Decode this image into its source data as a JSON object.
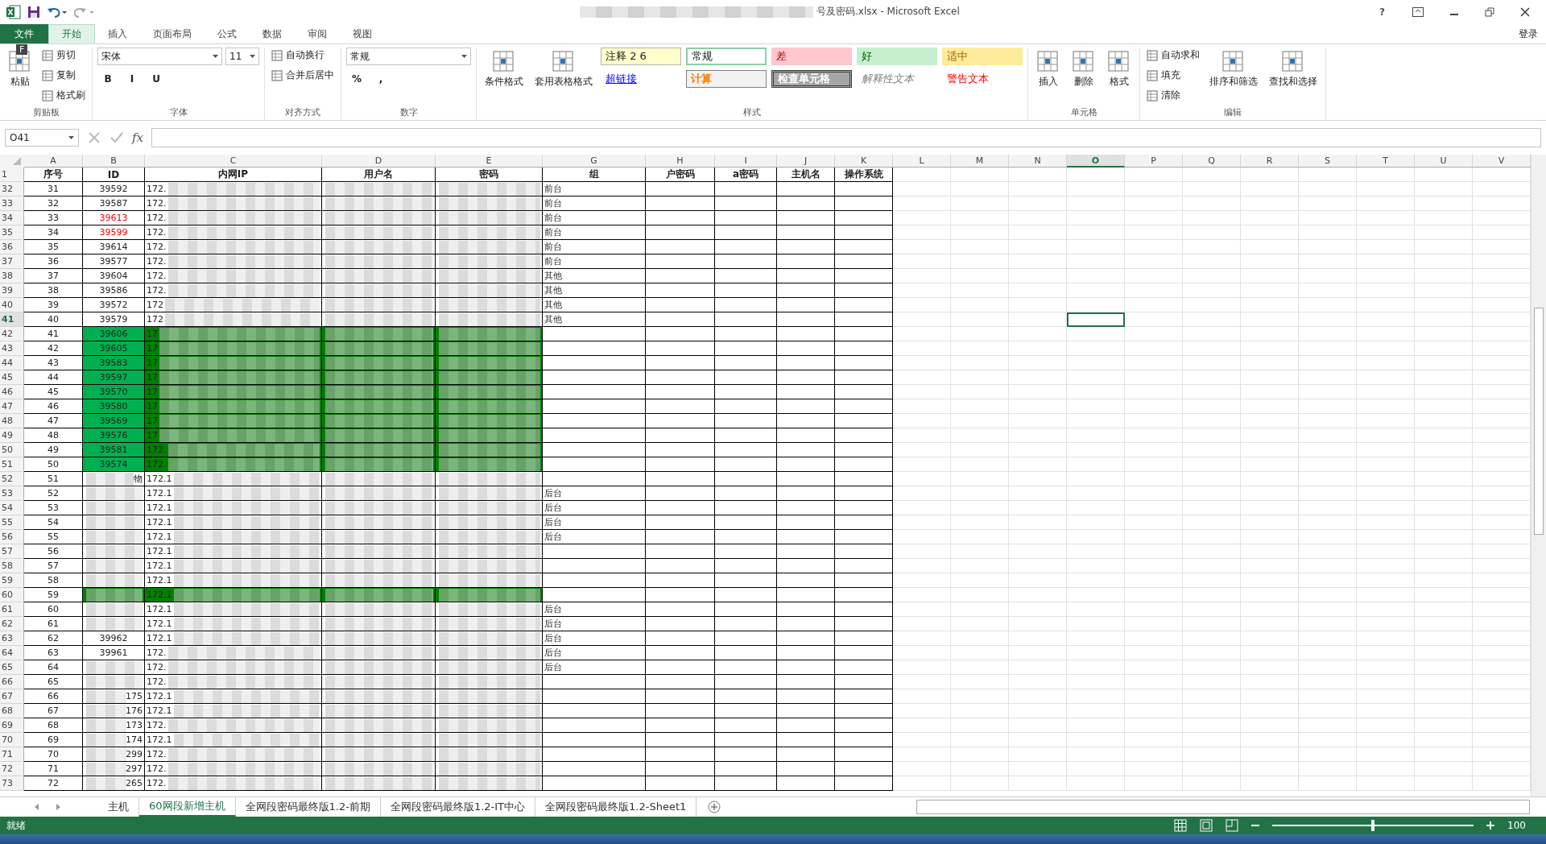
{
  "window": {
    "title": "号及密码.xlsx - Microsoft Excel",
    "help": "?",
    "sign_in": "登录"
  },
  "tabs": [
    {
      "label": "文件",
      "kind": "file",
      "selected": false
    },
    {
      "label": "开始",
      "kind": "tab",
      "selected": true
    },
    {
      "label": "插入",
      "kind": "tab",
      "selected": false
    },
    {
      "label": "页面布局",
      "kind": "tab",
      "selected": false
    },
    {
      "label": "公式",
      "kind": "tab",
      "selected": false
    },
    {
      "label": "数据",
      "kind": "tab",
      "selected": false
    },
    {
      "label": "审阅",
      "kind": "tab",
      "selected": false
    },
    {
      "label": "视图",
      "kind": "tab",
      "selected": false
    }
  ],
  "key_tip": "F",
  "ribbon": [
    {
      "label": "剪贴板",
      "columns": [
        {
          "items": [
            {
              "kind": "large",
              "label": "粘贴"
            }
          ]
        },
        {
          "items": [
            {
              "kind": "small",
              "label": "剪切"
            },
            {
              "kind": "small",
              "label": "复制"
            },
            {
              "kind": "small",
              "label": "格式刷"
            }
          ]
        }
      ]
    },
    {
      "label": "字体",
      "columns": [
        {
          "items": [
            {
              "kind": "fields",
              "labels": [
                "宋体",
                "11"
              ]
            },
            {
              "kind": "glyphs",
              "labels": [
                "B",
                "I",
                "U"
              ]
            }
          ]
        }
      ]
    },
    {
      "label": "对齐方式",
      "columns": [
        {
          "items": [
            {
              "kind": "small",
              "label": "自动换行"
            },
            {
              "kind": "small",
              "label": "合并后居中"
            }
          ]
        }
      ]
    },
    {
      "label": "数字",
      "columns": [
        {
          "items": [
            {
              "kind": "fields",
              "labels": [
                "常规"
              ]
            },
            {
              "kind": "glyphs",
              "labels": [
                "%",
                ","
              ]
            }
          ]
        }
      ]
    },
    {
      "label": "样式",
      "columns": [
        {
          "items": [
            {
              "kind": "large",
              "label": "条件格式"
            }
          ]
        },
        {
          "items": [
            {
              "kind": "large",
              "label": "套用表格格式"
            }
          ]
        },
        {
          "items": [
            {
              "kind": "style",
              "label": "注释 2 6"
            },
            {
              "kind": "style",
              "label": "超链接"
            }
          ]
        },
        {
          "items": [
            {
              "kind": "style",
              "label": "常规"
            },
            {
              "kind": "style",
              "label": "计算"
            }
          ]
        },
        {
          "items": [
            {
              "kind": "style",
              "label": "差"
            },
            {
              "kind": "style",
              "label": "检查单元格"
            }
          ]
        },
        {
          "items": [
            {
              "kind": "style",
              "label": "好"
            },
            {
              "kind": "style",
              "label": "解释性文本"
            }
          ]
        },
        {
          "items": [
            {
              "kind": "style",
              "label": "适中"
            },
            {
              "kind": "style",
              "label": "警告文本"
            }
          ]
        }
      ]
    },
    {
      "label": "单元格",
      "columns": [
        {
          "items": [
            {
              "kind": "large",
              "label": "插入"
            }
          ]
        },
        {
          "items": [
            {
              "kind": "large",
              "label": "删除"
            }
          ]
        },
        {
          "items": [
            {
              "kind": "large",
              "label": "格式"
            }
          ]
        }
      ]
    },
    {
      "label": "编辑",
      "columns": [
        {
          "items": [
            {
              "kind": "small",
              "label": "自动求和"
            },
            {
              "kind": "small",
              "label": "填充"
            },
            {
              "kind": "small",
              "label": "清除"
            }
          ]
        },
        {
          "items": [
            {
              "kind": "large",
              "label": "排序和筛选"
            }
          ]
        },
        {
          "items": [
            {
              "kind": "large",
              "label": "查找和选择"
            }
          ]
        }
      ]
    }
  ],
  "formula_bar": {
    "name_box": "O41",
    "fx": "fx"
  },
  "header_row": "1",
  "columns": [
    {
      "letter": "A",
      "heading": "序号",
      "redacted": false,
      "active": false
    },
    {
      "letter": "B",
      "heading": "ID",
      "redacted": false,
      "active": false
    },
    {
      "letter": "C",
      "heading": "内网IP",
      "redacted": true,
      "active": false
    },
    {
      "letter": "D",
      "heading": "用户名",
      "redacted": true,
      "active": false
    },
    {
      "letter": "E",
      "heading": "密码",
      "redacted": true,
      "active": false
    },
    {
      "letter": "G",
      "heading": "组",
      "redacted": false,
      "active": false
    },
    {
      "letter": "H",
      "heading": "户密码",
      "redacted": false,
      "active": false
    },
    {
      "letter": "I",
      "heading": "a密码",
      "redacted": false,
      "active": false
    },
    {
      "letter": "J",
      "heading": "主机名",
      "redacted": false,
      "active": false
    },
    {
      "letter": "K",
      "heading": "操作系统",
      "redacted": false,
      "active": false
    },
    {
      "letter": "L",
      "active": false
    },
    {
      "letter": "M",
      "active": false
    },
    {
      "letter": "N",
      "active": false
    },
    {
      "letter": "O",
      "active": true
    },
    {
      "letter": "P",
      "active": false
    },
    {
      "letter": "Q",
      "active": false
    },
    {
      "letter": "R",
      "active": false
    },
    {
      "letter": "S",
      "active": false
    },
    {
      "letter": "T",
      "active": false
    },
    {
      "letter": "U",
      "active": false
    },
    {
      "letter": "V",
      "active": false
    }
  ],
  "rows": [
    {
      "number": "32",
      "seq": "31",
      "id": "39592",
      "id_red": false,
      "id_redacted": false,
      "ip": "172.",
      "group": "前台",
      "highlighted": false,
      "active": false
    },
    {
      "number": "33",
      "seq": "32",
      "id": "39587",
      "id_red": false,
      "id_redacted": false,
      "ip": "172.",
      "group": "前台",
      "highlighted": false,
      "active": false
    },
    {
      "number": "34",
      "seq": "33",
      "id": "39613",
      "id_red": true,
      "id_redacted": false,
      "ip": "172.",
      "group": "前台",
      "highlighted": false,
      "active": false
    },
    {
      "number": "35",
      "seq": "34",
      "id": "39599",
      "id_red": true,
      "id_redacted": false,
      "ip": "172.",
      "group": "前台",
      "highlighted": false,
      "active": false
    },
    {
      "number": "36",
      "seq": "35",
      "id": "39614",
      "id_red": false,
      "id_redacted": false,
      "ip": "172.",
      "group": "前台",
      "highlighted": false,
      "active": false
    },
    {
      "number": "37",
      "seq": "36",
      "id": "39577",
      "id_red": false,
      "id_redacted": false,
      "ip": "172.",
      "group": "前台",
      "highlighted": false,
      "active": false
    },
    {
      "number": "38",
      "seq": "37",
      "id": "39604",
      "id_red": false,
      "id_redacted": false,
      "ip": "172.",
      "group": "其他",
      "highlighted": false,
      "active": false
    },
    {
      "number": "39",
      "seq": "38",
      "id": "39586",
      "id_red": false,
      "id_redacted": false,
      "ip": "172.",
      "group": "其他",
      "highlighted": false,
      "active": false
    },
    {
      "number": "40",
      "seq": "39",
      "id": "39572",
      "id_red": false,
      "id_redacted": false,
      "ip": "172",
      "group": "其他",
      "highlighted": false,
      "active": false
    },
    {
      "number": "41",
      "seq": "40",
      "id": "39579",
      "id_red": false,
      "id_redacted": false,
      "ip": "172",
      "group": "其他",
      "highlighted": false,
      "active": true
    },
    {
      "number": "42",
      "seq": "41",
      "id": "39606",
      "id_red": false,
      "id_redacted": false,
      "ip": "17",
      "highlighted": true,
      "active": false
    },
    {
      "number": "43",
      "seq": "42",
      "id": "39605",
      "id_red": false,
      "id_redacted": false,
      "ip": "17",
      "highlighted": true,
      "active": false
    },
    {
      "number": "44",
      "seq": "43",
      "id": "39583",
      "id_red": false,
      "id_redacted": false,
      "ip": "17",
      "highlighted": true,
      "active": false
    },
    {
      "number": "45",
      "seq": "44",
      "id": "39597",
      "id_red": false,
      "id_redacted": false,
      "ip": "17",
      "highlighted": true,
      "active": false
    },
    {
      "number": "46",
      "seq": "45",
      "id": "39570",
      "id_red": false,
      "id_redacted": false,
      "ip": "17",
      "highlighted": true,
      "active": false
    },
    {
      "number": "47",
      "seq": "46",
      "id": "39580",
      "id_red": false,
      "id_redacted": false,
      "ip": "17",
      "highlighted": true,
      "active": false
    },
    {
      "number": "48",
      "seq": "47",
      "id": "39569",
      "id_red": false,
      "id_redacted": false,
      "ip": "17",
      "highlighted": true,
      "active": false
    },
    {
      "number": "49",
      "seq": "48",
      "id": "39576",
      "id_red": false,
      "id_redacted": false,
      "ip": "17",
      "highlighted": true,
      "active": false
    },
    {
      "number": "50",
      "seq": "49",
      "id": "39581",
      "id_red": false,
      "id_redacted": false,
      "ip": "172.",
      "highlighted": true,
      "active": false
    },
    {
      "number": "51",
      "seq": "50",
      "id": "39574",
      "id_red": false,
      "id_redacted": false,
      "ip": "172.",
      "highlighted": true,
      "active": false
    },
    {
      "number": "52",
      "seq": "51",
      "id": "物",
      "id_red": false,
      "id_redacted": true,
      "ip": "172.1",
      "highlighted": false,
      "active": false
    },
    {
      "number": "53",
      "seq": "52",
      "id_red": false,
      "id_redacted": true,
      "ip": "172.1",
      "group": "后台",
      "highlighted": false,
      "active": false
    },
    {
      "number": "54",
      "seq": "53",
      "id_red": false,
      "id_redacted": true,
      "ip": "172.1",
      "group": "后台",
      "highlighted": false,
      "active": false
    },
    {
      "number": "55",
      "seq": "54",
      "id_red": false,
      "id_redacted": true,
      "ip": "172.1",
      "group": "后台",
      "highlighted": false,
      "active": false
    },
    {
      "number": "56",
      "seq": "55",
      "id_red": false,
      "id_redacted": true,
      "ip": "172.1",
      "group": "后台",
      "highlighted": false,
      "active": false
    },
    {
      "number": "57",
      "seq": "56",
      "id_red": false,
      "id_redacted": true,
      "ip": "172.1",
      "highlighted": false,
      "active": false
    },
    {
      "number": "58",
      "seq": "57",
      "id_red": false,
      "id_redacted": true,
      "ip": "172.1",
      "highlighted": false,
      "active": false
    },
    {
      "number": "59",
      "seq": "58",
      "id_red": false,
      "id_redacted": true,
      "ip": "172.1",
      "highlighted": false,
      "active": false
    },
    {
      "number": "60",
      "seq": "59",
      "id_red": false,
      "id_redacted": true,
      "ip": "172.1",
      "highlighted": true,
      "active": false
    },
    {
      "number": "61",
      "seq": "60",
      "id_red": false,
      "id_redacted": true,
      "ip": "172.1",
      "group": "后台",
      "highlighted": false,
      "active": false
    },
    {
      "number": "62",
      "seq": "61",
      "id_red": false,
      "id_redacted": true,
      "ip": "172.1",
      "group": "后台",
      "highlighted": false,
      "active": false
    },
    {
      "number": "63",
      "seq": "62",
      "id": "39962",
      "id_red": false,
      "id_redacted": false,
      "ip": "172.1",
      "group": "后台",
      "highlighted": false,
      "active": false
    },
    {
      "number": "64",
      "seq": "63",
      "id": "39961",
      "id_red": false,
      "id_redacted": false,
      "ip": "172.",
      "group": "后台",
      "highlighted": false,
      "active": false
    },
    {
      "number": "65",
      "seq": "64",
      "id_red": false,
      "id_redacted": true,
      "ip": "172.",
      "group": "后台",
      "highlighted": false,
      "active": false
    },
    {
      "number": "66",
      "seq": "65",
      "id_red": false,
      "id_redacted": true,
      "ip": "172.",
      "highlighted": false,
      "active": false
    },
    {
      "number": "67",
      "seq": "66",
      "id": "175",
      "id_red": false,
      "id_redacted": true,
      "ip": "172.1",
      "highlighted": false,
      "active": false
    },
    {
      "number": "68",
      "seq": "67",
      "id": "176",
      "id_red": false,
      "id_redacted": true,
      "ip": "172.1",
      "highlighted": false,
      "active": false
    },
    {
      "number": "69",
      "seq": "68",
      "id": "173",
      "id_red": false,
      "id_redacted": true,
      "ip": "172.",
      "highlighted": false,
      "active": false
    },
    {
      "number": "70",
      "seq": "69",
      "id": "174",
      "id_red": false,
      "id_redacted": true,
      "ip": "172.1",
      "highlighted": false,
      "active": false
    },
    {
      "number": "71",
      "seq": "70",
      "id": "299",
      "id_red": false,
      "id_redacted": true,
      "ip": "172.",
      "highlighted": false,
      "active": false
    },
    {
      "number": "72",
      "seq": "71",
      "id": "297",
      "id_red": false,
      "id_redacted": true,
      "ip": "172.",
      "highlighted": false,
      "active": false
    },
    {
      "number": "73",
      "seq": "72",
      "id": "265",
      "id_red": false,
      "id_redacted": true,
      "ip": "172.",
      "highlighted": false,
      "active": false
    }
  ],
  "sheet_tabs": [
    {
      "label": "主机",
      "selected": false
    },
    {
      "label": "60网段新增主机",
      "selected": true
    },
    {
      "label": "全网段密码最终版1.2-前期",
      "selected": false
    },
    {
      "label": "全网段密码最终版1.2-IT中心",
      "selected": false
    },
    {
      "label": "全网段密码最终版1.2-Sheet1",
      "selected": false
    }
  ],
  "status_bar": {
    "text": "就绪",
    "zoom": {
      "level": 0.5,
      "reading": "100"
    }
  }
}
